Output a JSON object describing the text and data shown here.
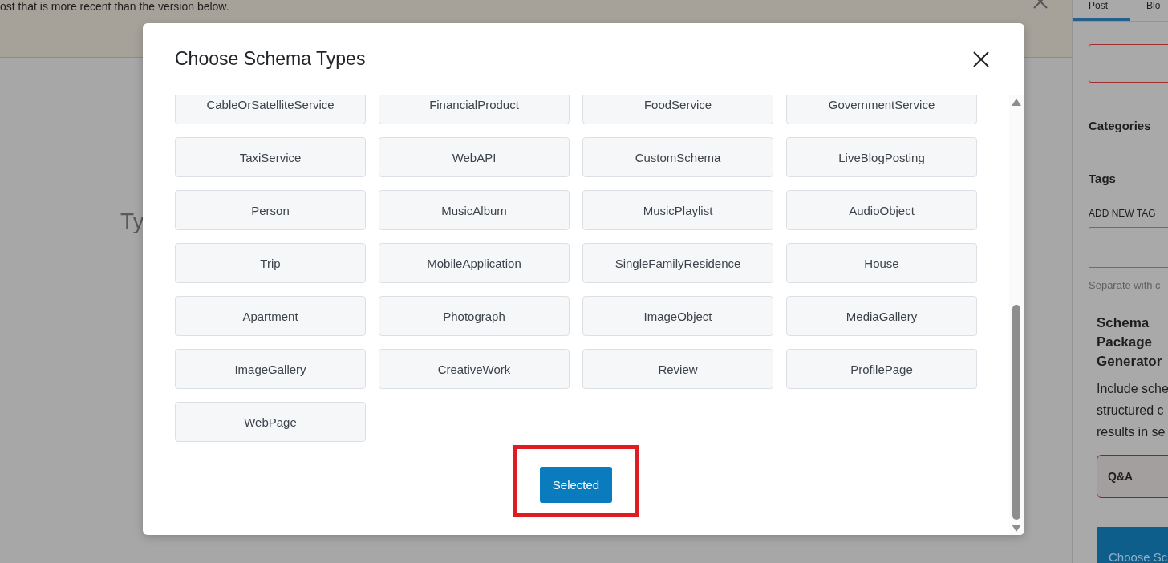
{
  "notice": {
    "text": "ost that is more recent than the version below."
  },
  "editor": {
    "placeholder": "Ty"
  },
  "sidebar": {
    "tabs": [
      {
        "label": "Post",
        "selected": true
      },
      {
        "label": "Blo",
        "selected": false
      }
    ],
    "categories": "Categories",
    "tags": {
      "title": "Tags",
      "add_label": "ADD NEW TAG",
      "help": "Separate with c"
    },
    "schema": {
      "title": "Schema Package Generator",
      "description": [
        "Include sche",
        "structured c",
        "results in se"
      ],
      "chosen": "Q&A",
      "button": "Choose Sc"
    }
  },
  "modal": {
    "title": "Choose Schema Types",
    "types": [
      "CableOrSatelliteService",
      "FinancialProduct",
      "FoodService",
      "GovernmentService",
      "TaxiService",
      "WebAPI",
      "CustomSchema",
      "LiveBlogPosting",
      "Person",
      "MusicAlbum",
      "MusicPlaylist",
      "AudioObject",
      "Trip",
      "MobileApplication",
      "SingleFamilyResidence",
      "House",
      "Apartment",
      "Photograph",
      "ImageObject",
      "MediaGallery",
      "ImageGallery",
      "CreativeWork",
      "Review",
      "ProfilePage",
      "WebPage"
    ],
    "submit": {
      "label": "Selected",
      "highlighted": true
    }
  }
}
